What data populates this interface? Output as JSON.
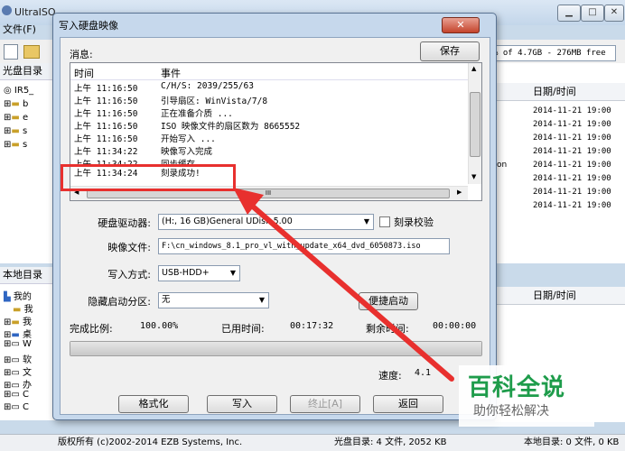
{
  "app": {
    "title": "UltraISO",
    "menu_file": "文件(F)",
    "capacity": "% of 4.7GB - 276MB free",
    "cd_dir_label": "光盘目录",
    "local_dir_label": "本地目录",
    "tree_top": [
      "IR5_",
      "b",
      "e",
      "s",
      "s"
    ],
    "tree_local": [
      "我的",
      "我",
      "我",
      "桌",
      "W",
      "软",
      "文",
      "办",
      "C",
      "C"
    ],
    "date_header": "日期/时间",
    "dates": [
      "2014-11-21 19:00",
      "2014-11-21 19:00",
      "2014-11-21 19:00",
      "2014-11-21 19:00",
      "2014-11-21 19:00",
      "2014-11-21 19:00",
      "2014-11-21 19:00",
      "2014-11-21 19:00"
    ],
    "partial_text": "on",
    "date_header_2": "日期/时间",
    "status": {
      "copyright": "版权所有 (c)2002-2014 EZB Systems, Inc.",
      "cd_count": "光盘目录: 4 文件, 2052 KB",
      "local_count": "本地目录: 0 文件, 0 KB"
    }
  },
  "dialog": {
    "title": "写入硬盘映像",
    "close_label": "✕",
    "messages_label": "消息:",
    "save_button": "保存",
    "col_time": "时间",
    "col_event": "事件",
    "log": [
      {
        "time": "上午 11:16:50",
        "event": "C/H/S: 2039/255/63"
      },
      {
        "time": "上午 11:16:50",
        "event": "引导扇区: WinVista/7/8"
      },
      {
        "time": "上午 11:16:50",
        "event": "正在准备介质 ..."
      },
      {
        "time": "上午 11:16:50",
        "event": "ISO 映像文件的扇区数为 8665552"
      },
      {
        "time": "上午 11:16:50",
        "event": "开始写入 ..."
      },
      {
        "time": "上午 11:34:22",
        "event": "映像写入完成"
      },
      {
        "time": "上午 11:34:22",
        "event": "同步缓存"
      },
      {
        "time": "上午 11:34:24",
        "event": "刻录成功!"
      }
    ],
    "hscroll_grip": "III",
    "drive_label": "硬盘驱动器:",
    "drive_value": "(H:, 16 GB)General UDisk          5.00",
    "verify_label": "刻录校验",
    "image_label": "映像文件:",
    "image_value": "F:\\cn_windows_8.1_pro_vl_with_update_x64_dvd_6050873.iso",
    "method_label": "写入方式:",
    "method_value": "USB-HDD+",
    "hidden_label": "隐藏启动分区:",
    "hidden_value": "无",
    "quick_boot": "便捷启动",
    "done_label": "完成比例:",
    "done_value": "100.00%",
    "elapsed_label": "已用时间:",
    "elapsed_value": "00:17:32",
    "remain_label": "剩余时间:",
    "remain_value": "00:00:00",
    "progress": 1.0,
    "speed_label": "速度:",
    "speed_value": "4.1",
    "btn_format": "格式化",
    "btn_write": "写入",
    "btn_stop": "终止[A]",
    "btn_back": "返回"
  },
  "watermark": {
    "main": "百科全说",
    "sub": "助你轻松解决"
  },
  "colors": {
    "annotation": "#e8302e",
    "watermark": "#1e9c4b"
  }
}
